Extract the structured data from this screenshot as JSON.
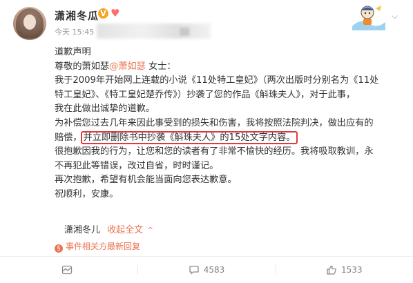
{
  "post": {
    "author": "潇湘冬瓜",
    "verified_badge": "V",
    "time": "今天 15:45",
    "lines": [
      "道歉声明",
      "尊敬的萧如瑟",
      "@萧如瑟",
      " 女士：",
      "我于2009年开始网上连载的小说《11处特工皇妃》（两次出版时分别名为《11处",
      "特工皇妃》、《特工皇妃楚乔传》）抄袭了您的作品《斛珠夫人》，对于此事，",
      "我在此做出诚挚的道歉。",
      "为补偿您过去几年来因此事受到的损失和伤害，我将按照法院判决，做出应有的",
      "赔偿，",
      "并立即删除书中抄袭《斛珠夫人》的15处文字内容。",
      "很抱歉因我的行为，让您和您的读者有了非常不愉快的经历。我将吸取教训，永",
      "不再犯此等错误，改过自省，时时谨记。",
      "再次抱歉，希望有机会能当面向您表达歉意。",
      "祝顺利，安康。"
    ],
    "signature": "潇湘冬儿",
    "collapse_label": "收起全文",
    "collapse_icon": "^",
    "event_label": "事件相关方最新回复",
    "event_icon": "§"
  },
  "actions": {
    "repost_count": "",
    "comment_count": "4583",
    "like_count": "1533"
  },
  "colors": {
    "link": "#eb7350",
    "highlight_box": "#e23a3a",
    "verified": "#f5a623"
  }
}
